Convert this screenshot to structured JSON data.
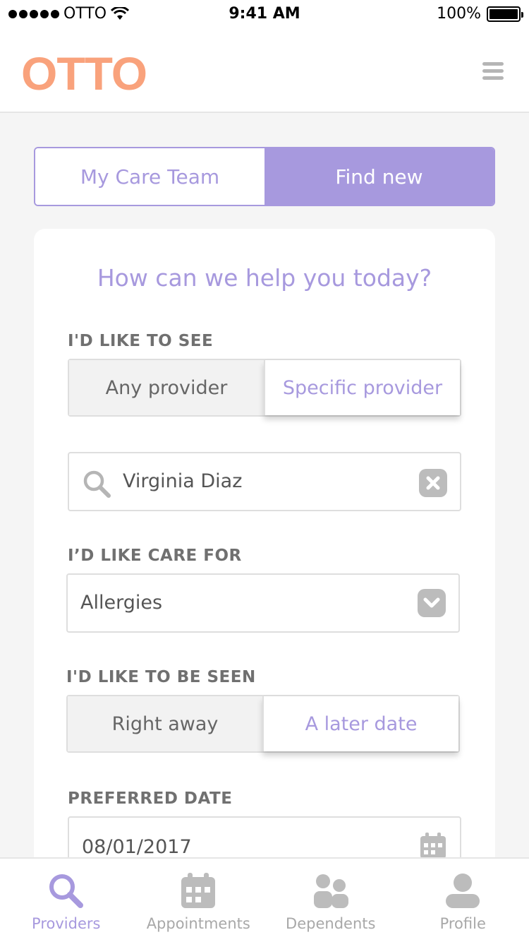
{
  "status_bar": {
    "carrier": "OTTO",
    "time": "9:41 AM",
    "battery": "100%"
  },
  "header": {
    "logo": "OTTO"
  },
  "tabs": [
    {
      "label": "My Care Team",
      "active": false
    },
    {
      "label": "Find new",
      "active": true
    }
  ],
  "form": {
    "title": "How can we help you today?",
    "see": {
      "label": "I'D LIKE TO SEE",
      "options": [
        "Any provider",
        "Specific provider"
      ],
      "selected": "Specific provider"
    },
    "search": {
      "value": "Virginia Diaz"
    },
    "care": {
      "label": "I’D LIKE CARE FOR",
      "value": "Allergies"
    },
    "seen": {
      "label": "I'D LIKE TO BE SEEN",
      "options": [
        "Right away",
        "A later date"
      ],
      "selected": "A later date"
    },
    "date": {
      "label": "PREFERRED DATE",
      "value": "08/01/2017"
    }
  },
  "bottom_nav": [
    {
      "label": "Providers",
      "icon": "search-icon",
      "active": true
    },
    {
      "label": "Appointments",
      "icon": "calendar-icon",
      "active": false
    },
    {
      "label": "Dependents",
      "icon": "group-icon",
      "active": false
    },
    {
      "label": "Profile",
      "icon": "person-icon",
      "active": false
    }
  ],
  "colors": {
    "accent": "#a799de",
    "logo": "#f9a27c",
    "inactive": "#a8a8a8"
  }
}
